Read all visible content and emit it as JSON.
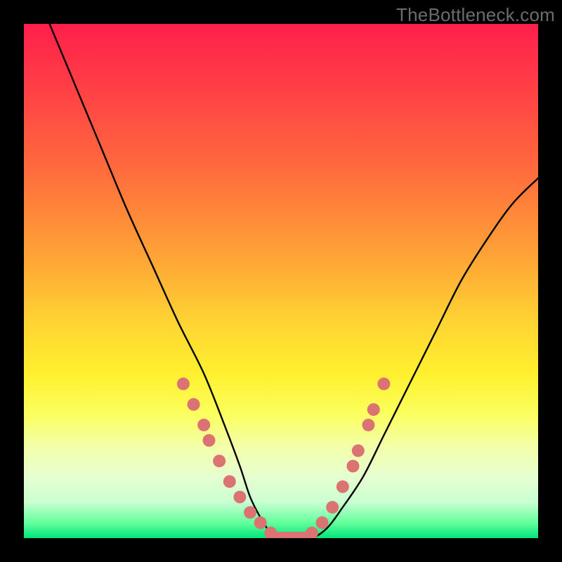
{
  "watermark": {
    "text": "TheBottleneck.com"
  },
  "colors": {
    "frame": "#000000",
    "curve": "#000000",
    "dot": "#db7373",
    "flat_green": "#00e57a"
  },
  "chart_data": {
    "type": "line",
    "title": "",
    "xlabel": "",
    "ylabel": "",
    "xlim": [
      0,
      100
    ],
    "ylim": [
      0,
      100
    ],
    "grid": false,
    "legend": false,
    "series": [
      {
        "name": "bottleneck-curve",
        "x": [
          5,
          10,
          15,
          20,
          25,
          30,
          35,
          39,
          42,
          44,
          46,
          48,
          50,
          53,
          56,
          59,
          62,
          66,
          70,
          75,
          80,
          85,
          90,
          95,
          100
        ],
        "y": [
          100,
          88,
          76,
          64,
          53,
          42,
          32,
          22,
          14,
          8,
          4,
          1,
          0,
          0,
          0,
          2,
          6,
          12,
          20,
          30,
          40,
          50,
          58,
          65,
          70
        ]
      }
    ],
    "markers": [
      {
        "x": 31,
        "y": 30
      },
      {
        "x": 33,
        "y": 26
      },
      {
        "x": 35,
        "y": 22
      },
      {
        "x": 36,
        "y": 19
      },
      {
        "x": 38,
        "y": 15
      },
      {
        "x": 40,
        "y": 11
      },
      {
        "x": 42,
        "y": 8
      },
      {
        "x": 44,
        "y": 5
      },
      {
        "x": 46,
        "y": 3
      },
      {
        "x": 48,
        "y": 1
      },
      {
        "x": 50,
        "y": 0
      },
      {
        "x": 52,
        "y": 0
      },
      {
        "x": 54,
        "y": 0
      },
      {
        "x": 56,
        "y": 1
      },
      {
        "x": 58,
        "y": 3
      },
      {
        "x": 60,
        "y": 6
      },
      {
        "x": 62,
        "y": 10
      },
      {
        "x": 64,
        "y": 14
      },
      {
        "x": 65,
        "y": 17
      },
      {
        "x": 67,
        "y": 22
      },
      {
        "x": 68,
        "y": 25
      },
      {
        "x": 70,
        "y": 30
      }
    ]
  }
}
